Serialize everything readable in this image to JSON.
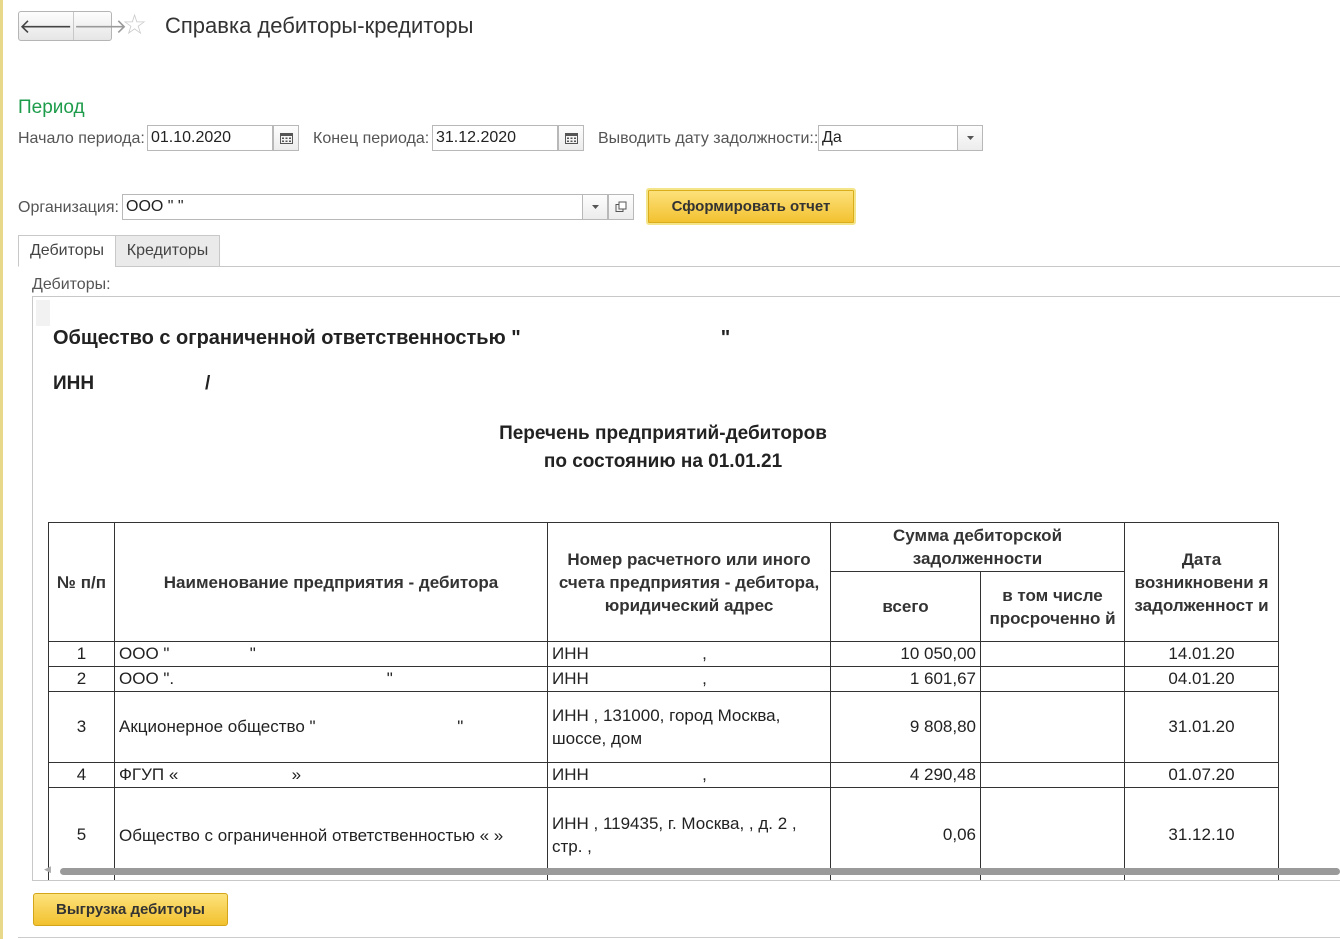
{
  "window": {
    "title": "Справка дебиторы-кредиторы",
    "nav_back": "🡐",
    "nav_forward": "🡒",
    "favorite_icon": "☆"
  },
  "period": {
    "section_label": "Период",
    "start_label": "Начало периода:",
    "start_value": "01.10.2020",
    "end_label": "Конец периода:",
    "end_value": "31.12.2020",
    "show_date_label": "Выводить дату задолжности::",
    "show_date_value": "Да"
  },
  "organization": {
    "label": "Организация:",
    "value": "ООО \"                        \""
  },
  "buttons": {
    "generate": "Сформировать отчет",
    "export": "Выгрузка дебиторы"
  },
  "tabs": [
    {
      "label": "Дебиторы",
      "active": true
    },
    {
      "label": "Кредиторы",
      "active": false
    }
  ],
  "report_panel_label": "Дебиторы:",
  "report": {
    "company": "Общество с ограниченной ответственностью \"                                    \"",
    "inn": "ИНН                     /",
    "heading_line1": "Перечень предприятий-дебиторов",
    "heading_line2": "по состоянию на 01.01.21",
    "headers": {
      "num": "№ п/п",
      "name": "Наименование предприятия - дебитора",
      "account": "Номер расчетного или иного счета предприятия - дебитора, юридический адрес",
      "sum_group": "Сумма дебиторской задолженности",
      "total": "всего",
      "overdue": "в том числе просроченно й",
      "date": "Дата возникновени я задолженност и"
    },
    "rows": [
      {
        "num": "1",
        "name": "ООО \"                 \"",
        "account": "ИНН                        ,",
        "total": "10 050,00",
        "overdue": "",
        "date": "14.01.20"
      },
      {
        "num": "2",
        "name": "ООО \".                                             \"",
        "account": "ИНН                        ,",
        "total": "1 601,67",
        "overdue": "",
        "date": "04.01.20"
      },
      {
        "num": "3",
        "name": "Акционерное общество \"                              \"",
        "account": "ИНН                       , 131000, город Москва,               шоссе, дом",
        "total": "9 808,80",
        "overdue": "",
        "date": "31.01.20"
      },
      {
        "num": "4",
        "name": "ФГУП «                        »",
        "account": "ИНН                        ,",
        "total": "4 290,48",
        "overdue": "",
        "date": "01.07.20"
      },
      {
        "num": "5",
        "name": "Общество с ограниченной ответственностью «                                                 »",
        "account": "ИНН                       , 119435, г. Москва,               , д. 2 , стр.   ,",
        "total": "0,06",
        "overdue": "",
        "date": "31.12.10"
      }
    ]
  }
}
